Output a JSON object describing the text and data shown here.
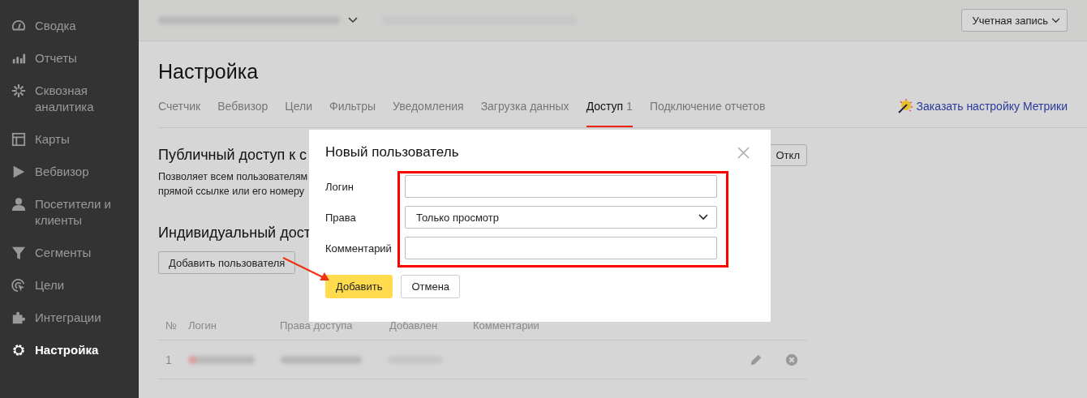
{
  "sidebar": {
    "items": [
      {
        "label": "Сводка",
        "selected": false
      },
      {
        "label": "Отчеты",
        "selected": false
      },
      {
        "label": "Сквозная аналитика",
        "selected": false
      },
      {
        "label": "Карты",
        "selected": false
      },
      {
        "label": "Вебвизор",
        "selected": false
      },
      {
        "label": "Посетители и клиенты",
        "selected": false
      },
      {
        "label": "Сегменты",
        "selected": false
      },
      {
        "label": "Цели",
        "selected": false
      },
      {
        "label": "Интеграции",
        "selected": false
      },
      {
        "label": "Настройка",
        "selected": true
      }
    ]
  },
  "header": {
    "account_button": "Учетная запись"
  },
  "page": {
    "title": "Настройка",
    "tabs": [
      {
        "label": "Счетчик",
        "selected": false
      },
      {
        "label": "Вебвизор",
        "selected": false
      },
      {
        "label": "Цели",
        "selected": false
      },
      {
        "label": "Фильтры",
        "selected": false
      },
      {
        "label": "Уведомления",
        "selected": false
      },
      {
        "label": "Загрузка данных",
        "selected": false
      },
      {
        "label": "Доступ",
        "count": "1",
        "selected": true
      },
      {
        "label": "Подключение отчетов",
        "selected": false
      }
    ],
    "order_link": "Заказать настройку Метрики",
    "public_access": {
      "title": "Публичный доступ к с",
      "description": [
        "Позволяет всем пользователям",
        "прямой ссылке или его номеру"
      ],
      "toggle_button": "Откл"
    },
    "individual_access": {
      "title": "Индивидуальный дост",
      "add_button": "Добавить пользователя"
    },
    "table": {
      "columns": [
        "№",
        "Логин",
        "Права доступа",
        "Добавлен",
        "Комментарии"
      ],
      "rows": [
        {
          "number": "1"
        }
      ]
    }
  },
  "dialog": {
    "title": "Новый пользователь",
    "fields": [
      {
        "label": "Логин",
        "kind": "text"
      },
      {
        "label": "Права",
        "kind": "select",
        "value": "Только просмотр"
      },
      {
        "label": "Комментарий",
        "kind": "text"
      }
    ],
    "buttons": [
      {
        "label": "Добавить",
        "kind": "primary"
      },
      {
        "label": "Отмена",
        "kind": "secondary"
      }
    ]
  }
}
